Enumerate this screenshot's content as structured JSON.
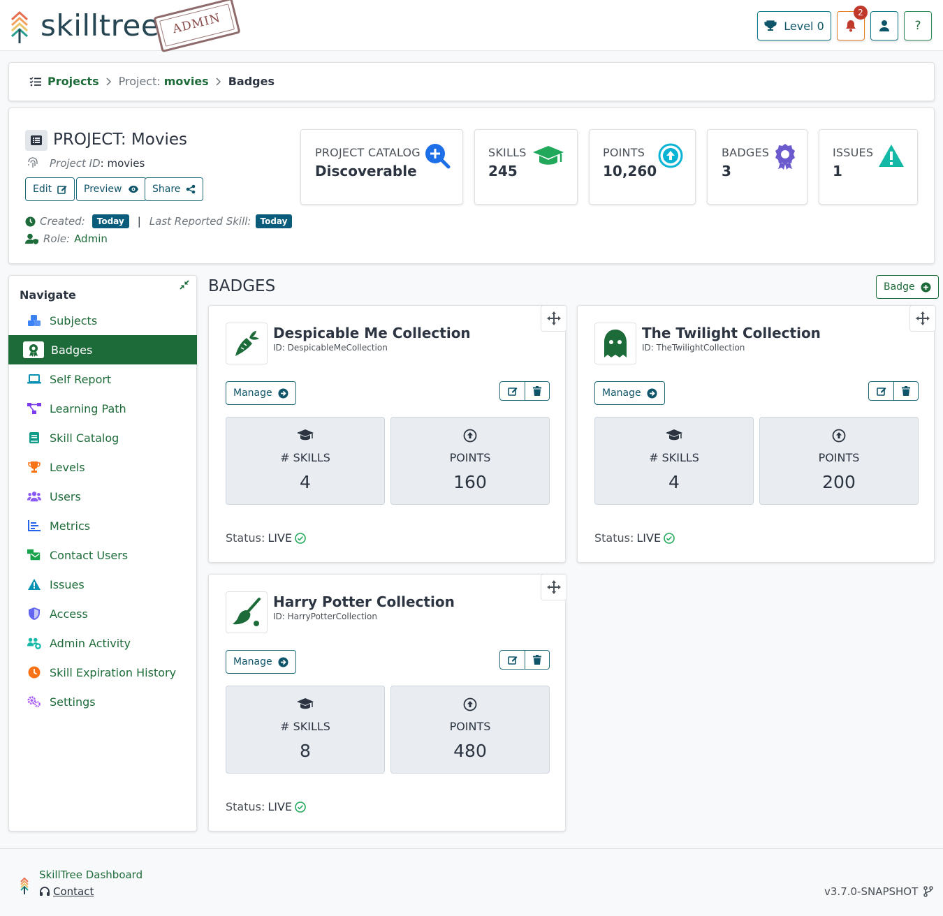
{
  "header": {
    "brand": "skilltree",
    "stamp": "ADMIN",
    "level_label": "Level 0",
    "notification_count": "2",
    "help_label": "?"
  },
  "breadcrumb": {
    "projects": "Projects",
    "project_prefix": "Project:",
    "project_name": "movies",
    "current": "Badges"
  },
  "project": {
    "title": "PROJECT: Movies",
    "id_label": "Project ID",
    "id_value": ": movies",
    "buttons": {
      "edit": "Edit",
      "preview": "Preview",
      "share": "Share"
    },
    "created_label": "Created:",
    "created_value": "Today",
    "separator": "|",
    "last_reported_label": "Last Reported Skill:",
    "last_reported_value": "Today",
    "role_label": "Role:",
    "role_value": "Admin",
    "stats": {
      "catalog_label": "PROJECT CATALOG",
      "catalog_value": "Discoverable",
      "skills_label": "SKILLS",
      "skills_value": "245",
      "points_label": "POINTS",
      "points_value": "10,260",
      "badges_label": "BADGES",
      "badges_value": "3",
      "issues_label": "ISSUES",
      "issues_value": "1"
    }
  },
  "nav": {
    "title": "Navigate",
    "items": [
      {
        "label": "Subjects",
        "icon": "cubes-icon",
        "color": "#3b82f6"
      },
      {
        "label": "Badges",
        "icon": "award-icon",
        "color": "#1e6b3a"
      },
      {
        "label": "Self Report",
        "icon": "laptop-icon",
        "color": "#0891b2"
      },
      {
        "label": "Learning Path",
        "icon": "project-diagram-icon",
        "color": "#7c3aed"
      },
      {
        "label": "Skill Catalog",
        "icon": "book-icon",
        "color": "#0f9d8a"
      },
      {
        "label": "Levels",
        "icon": "trophy-icon",
        "color": "#f97316"
      },
      {
        "label": "Users",
        "icon": "users-icon",
        "color": "#8b5cf6"
      },
      {
        "label": "Metrics",
        "icon": "chart-bar-icon",
        "color": "#2563eb"
      },
      {
        "label": "Contact Users",
        "icon": "mail-bulk-icon",
        "color": "#16a34a"
      },
      {
        "label": "Issues",
        "icon": "warning-icon",
        "color": "#0891b2"
      },
      {
        "label": "Access",
        "icon": "shield-icon",
        "color": "#6366f1"
      },
      {
        "label": "Admin Activity",
        "icon": "users-cog-icon",
        "color": "#14b8a6"
      },
      {
        "label": "Skill Expiration History",
        "icon": "clock-icon",
        "color": "#f97316"
      },
      {
        "label": "Settings",
        "icon": "cogs-icon",
        "color": "#a855f7"
      }
    ]
  },
  "badges_section": {
    "title": "BADGES",
    "add_label": "Badge",
    "manage_label": "Manage",
    "skills_label": "# SKILLS",
    "points_label": "POINTS",
    "status_label": "Status:",
    "status_value": "LIVE",
    "cards": [
      {
        "name": "Despicable Me Collection",
        "id": "ID: DespicableMeCollection",
        "skills": "4",
        "points": "160",
        "icon": "carrot-icon"
      },
      {
        "name": "The Twilight Collection",
        "id": "ID: TheTwilightCollection",
        "skills": "4",
        "points": "200",
        "icon": "ghost-icon"
      },
      {
        "name": "Harry Potter Collection",
        "id": "ID: HarryPotterCollection",
        "skills": "8",
        "points": "480",
        "icon": "broom-icon"
      }
    ]
  },
  "footer": {
    "title": "SkillTree Dashboard",
    "contact": "Contact",
    "version": "v3.7.0-SNAPSHOT"
  }
}
